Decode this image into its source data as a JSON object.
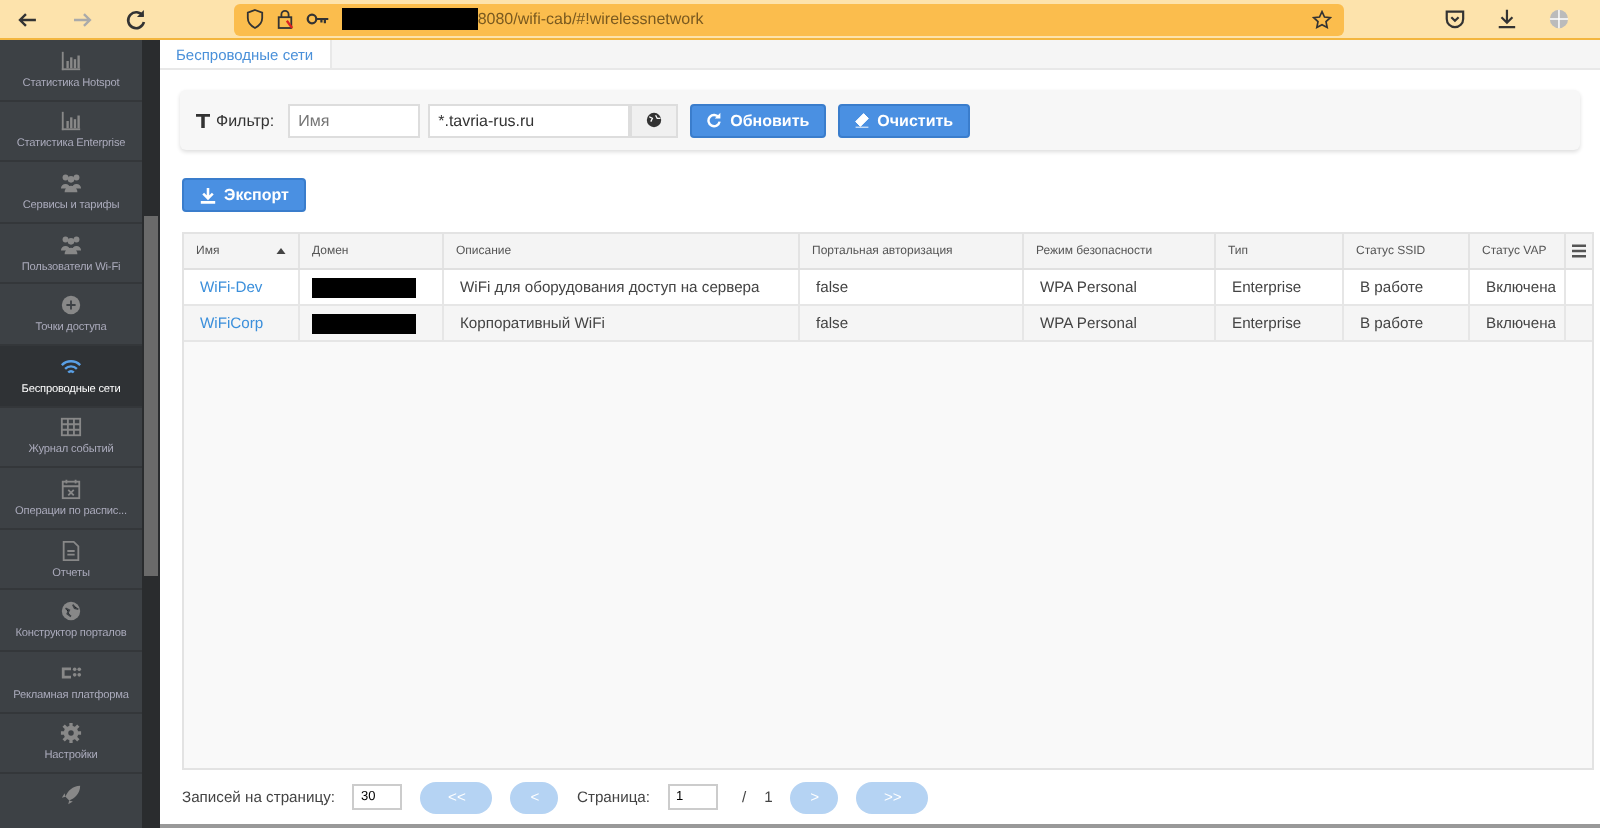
{
  "browser": {
    "url": "8080/wifi-cab/#!wirelessnetwork",
    "url_redacted": true
  },
  "sidebar": {
    "items": [
      {
        "label": "Статистика Hotspot",
        "selected": false
      },
      {
        "label": "Статистика Enterprise",
        "selected": false
      },
      {
        "label": "Сервисы и тарифы",
        "selected": false
      },
      {
        "label": "Пользователи Wi-Fi",
        "selected": false
      },
      {
        "label": "Точки доступа",
        "selected": false
      },
      {
        "label": "Беспроводные сети",
        "selected": true
      },
      {
        "label": "Журнал событий",
        "selected": false
      },
      {
        "label": "Операции по распис...",
        "selected": false
      },
      {
        "label": "Отчеты",
        "selected": false
      },
      {
        "label": "Конструктор порталов",
        "selected": false
      },
      {
        "label": "Рекламная платформа",
        "selected": false
      },
      {
        "label": "Настройки",
        "selected": false
      }
    ]
  },
  "tabs": [
    {
      "label": "Беспроводные сети",
      "selected": true
    }
  ],
  "filter": {
    "label": "Фильтр:",
    "name_placeholder": "Имя",
    "domain_value": "*.tavria-rus.ru",
    "refresh_button": "Обновить",
    "clear_button": "Очистить"
  },
  "export_button": "Экспорт",
  "table": {
    "columns": [
      "Имя",
      "Домен",
      "Описание",
      "Портальная авторизация",
      "Режим безопасности",
      "Тип",
      "Статус SSID",
      "Статус VAP"
    ],
    "rows": [
      {
        "name": "WiFi-Dev",
        "domain_redacted": true,
        "description": "WiFi для оборудования доступ на сервера",
        "portal_auth": "false",
        "security": "WPA Personal",
        "type": "Enterprise",
        "ssid_status": "В работе",
        "vap_status": "Включена"
      },
      {
        "name": "WiFiCorp",
        "domain_redacted": true,
        "description": "Корпоративный WiFi",
        "portal_auth": "false",
        "security": "WPA Personal",
        "type": "Enterprise",
        "ssid_status": "В работе",
        "vap_status": "Включена"
      }
    ]
  },
  "pagination": {
    "per_page_label": "Записей на страницу:",
    "per_page_value": "30",
    "page_label": "Страница:",
    "page_value": "1",
    "separator": "/",
    "total_pages": "1",
    "buttons": [
      {
        "label": "<<",
        "disabled": true
      },
      {
        "label": "<",
        "disabled": true
      },
      {
        "label": ">",
        "disabled": true
      },
      {
        "label": ">>",
        "disabled": true
      }
    ]
  }
}
